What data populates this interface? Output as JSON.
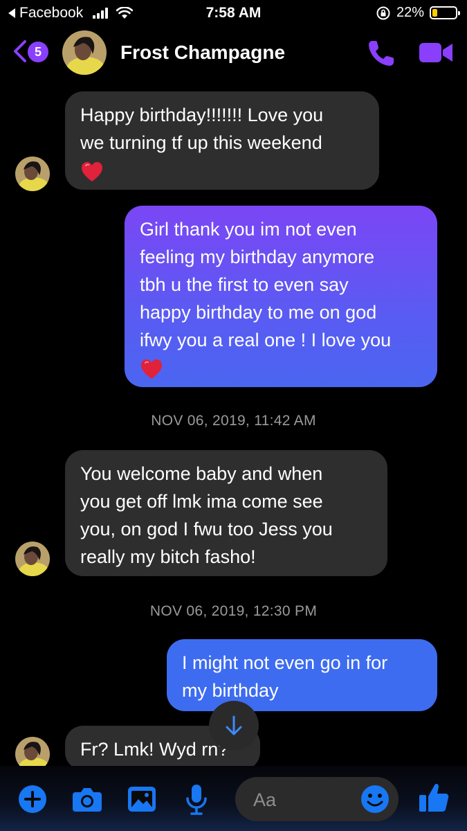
{
  "status_bar": {
    "back_app": "Facebook",
    "time": "7:58 AM",
    "battery": "22%",
    "battery_level": 0.22
  },
  "header": {
    "unread_count": "5",
    "contact_name": "Frost Champagne",
    "icons": [
      "back-chevron-icon",
      "phone-icon",
      "video-camera-icon"
    ]
  },
  "thread": {
    "messages": [
      {
        "direction": "incoming",
        "lines": [
          "Happy birthday!!!!!!! Love you",
          "we turning tf up this weekend"
        ],
        "emoji": "heart"
      },
      {
        "direction": "outgoing",
        "lines": [
          "Girl thank you im not even",
          "feeling my birthday anymore",
          "tbh u the first to even say",
          "happy birthday to me on god",
          "ifwy you a real one ! I love you"
        ],
        "emoji": "heart"
      },
      {
        "type": "timestamp",
        "text": "NOV 06, 2019, 11:42 AM"
      },
      {
        "direction": "incoming",
        "lines": [
          "You welcome baby and when",
          "you get off lmk ima come see",
          "you, on god I fwu too Jess you",
          "really my bitch fasho!"
        ]
      },
      {
        "type": "timestamp",
        "text": "NOV 06, 2019, 12:30 PM"
      },
      {
        "direction": "outgoing",
        "lines": [
          "I might not even go in for",
          "my birthday"
        ]
      },
      {
        "direction": "incoming",
        "lines": [
          "Fr? Lmk! Wyd rn?"
        ]
      }
    ]
  },
  "composer": {
    "placeholder": "Aa",
    "icons": [
      "plus-icon",
      "camera-icon",
      "gallery-icon",
      "microphone-icon",
      "emoji-icon",
      "thumbs-up-icon"
    ]
  },
  "colors": {
    "accent_purple": "#8a3ffc",
    "accent_blue": "#0a84ff",
    "incoming_bubble": "#2e2e2e",
    "outgoing_top": "#7b46f5",
    "outgoing_bottom": "#3d6cf0"
  }
}
